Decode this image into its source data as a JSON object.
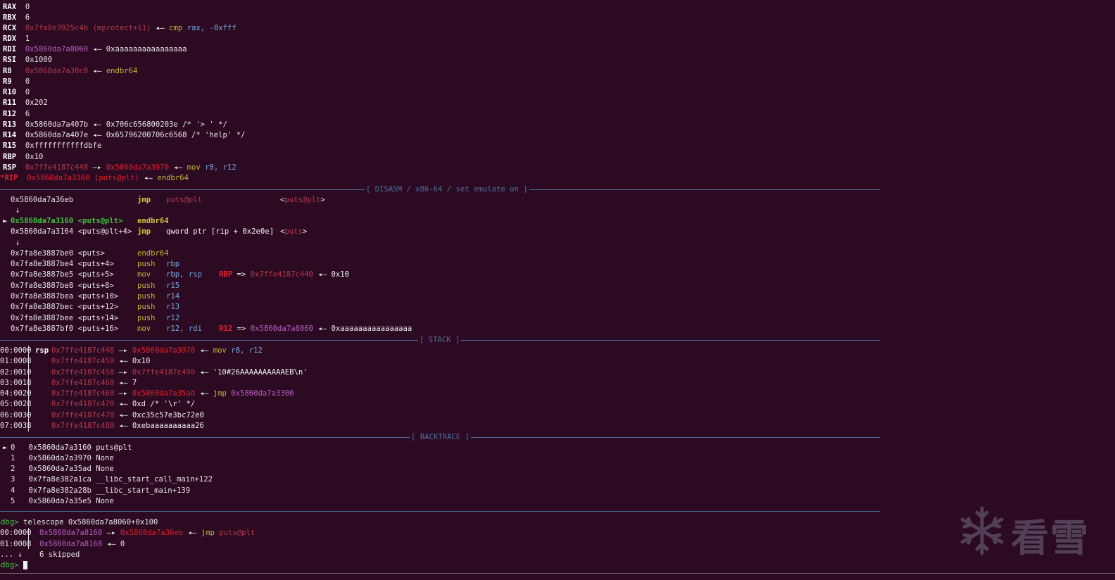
{
  "registers": [
    {
      "name": "RAX",
      "value": "0"
    },
    {
      "name": "RBX",
      "value": "6"
    },
    {
      "name": "RCX",
      "addr": "0x7fa8e3925c4b",
      "sym": "(mprotect+11)",
      "arrow": "◂—",
      "insn": "cmp",
      "ops": "rax, -0xfff"
    },
    {
      "name": "RDX",
      "value": "1"
    },
    {
      "name": "RDI",
      "addr": "0x5860da7a8060",
      "arrow": "◂—",
      "target": "0xaaaaaaaaaaaaaaaa"
    },
    {
      "name": "RSI",
      "value": "0x1000"
    },
    {
      "name": "R8",
      "addr": "0x5860da7a38c0",
      "arrow": "◂—",
      "insn": "endbr64"
    },
    {
      "name": "R9",
      "value": "0"
    },
    {
      "name": "R10",
      "value": "0"
    },
    {
      "name": "R11",
      "value": "0x202"
    },
    {
      "name": "R12",
      "value": "6"
    },
    {
      "name": "R13",
      "value": "0x5860da7a407b ◂— 0x706c656800203e /* '> ' */"
    },
    {
      "name": "R14",
      "value": "0x5860da7a407e ◂— 0x65796200706c6568 /* 'help' */"
    },
    {
      "name": "R15",
      "value": "0xfffffffffffdbfe"
    },
    {
      "name": "RBP",
      "value": "0x10"
    },
    {
      "name": "RSP",
      "addr": "0x7ffe4187c448",
      "arrow": "—▸",
      "addr2": "0x5860da7a3970",
      "arrow2": "◂—",
      "insn": "mov",
      "ops": "r8, r12"
    },
    {
      "name": "*RIP",
      "addr": "0x5860da7a3160",
      "sym": "(puts@plt)",
      "arrow": "◂—",
      "insn": "endbr64"
    }
  ],
  "headers": {
    "disasm": "[ DISASM / x86-64 / set emulate on ]",
    "stack": "[ STACK ]",
    "backtrace": "[ BACKTRACE ]"
  },
  "disasm": [
    {
      "addr": "0x5860da7a36eb",
      "label": "",
      "mn": "jmp",
      "op": "puts@plt",
      "cmt": "<puts@plt>"
    },
    {
      "down": "↓"
    },
    {
      "addr": "0x5860da7a3160",
      "label": "<puts@plt>",
      "mn": "endbr64",
      "current": true,
      "marker": "►"
    },
    {
      "addr": "0x5860da7a3164",
      "label": "<puts@plt+4>",
      "mn": "jmp",
      "op": "qword ptr [rip + 0x2e0e]",
      "cmt": "<puts>"
    },
    {
      "down": "↓"
    },
    {
      "addr": "0x7fa8e3887be0",
      "label": "<puts>",
      "mn": "endbr64"
    },
    {
      "addr": "0x7fa8e3887be4",
      "label": "<puts+4>",
      "mn": "push",
      "op": "rbp"
    },
    {
      "addr": "0x7fa8e3887be5",
      "label": "<puts+5>",
      "mn": "mov",
      "op": "rbp, rsp",
      "cmt": "RBP => 0x7ffe4187c440 ◂— 0x10"
    },
    {
      "addr": "0x7fa8e3887be8",
      "label": "<puts+8>",
      "mn": "push",
      "op": "r15"
    },
    {
      "addr": "0x7fa8e3887bea",
      "label": "<puts+10>",
      "mn": "push",
      "op": "r14"
    },
    {
      "addr": "0x7fa8e3887bec",
      "label": "<puts+12>",
      "mn": "push",
      "op": "r13"
    },
    {
      "addr": "0x7fa8e3887bee",
      "label": "<puts+14>",
      "mn": "push",
      "op": "r12"
    },
    {
      "addr": "0x7fa8e3887bf0",
      "label": "<puts+16>",
      "mn": "mov",
      "op": "r12, rdi",
      "cmt": "R12 => 0x5860da7a8060 ◂— 0xaaaaaaaaaaaaaaaa"
    }
  ],
  "stack": [
    {
      "off": "00:0000",
      "tag": "rsp",
      "addr": "0x7ffe4187c448",
      "rest": "—▸ 0x5860da7a3970 ◂— mov r8, r12"
    },
    {
      "off": "01:0008",
      "tag": "",
      "addr": "0x7ffe4187c450",
      "rest": "◂— 0x10"
    },
    {
      "off": "02:0010",
      "tag": "",
      "addr": "0x7ffe4187c458",
      "rest": "—▸ 0x7ffe4187c490 ◂— '10#26AAAAAAAAAAEB\\n'"
    },
    {
      "off": "03:0018",
      "tag": "",
      "addr": "0x7ffe4187c460",
      "rest": "◂— 7"
    },
    {
      "off": "04:0020",
      "tag": "",
      "addr": "0x7ffe4187c468",
      "rest": "—▸ 0x5860da7a35ad ◂— jmp 0x5860da7a3300"
    },
    {
      "off": "05:0028",
      "tag": "",
      "addr": "0x7ffe4187c470",
      "rest": "◂— 0xd /* '\\r' */"
    },
    {
      "off": "06:0030",
      "tag": "",
      "addr": "0x7ffe4187c478",
      "rest": "◂— 0xc35c57e3bc72e0"
    },
    {
      "off": "07:0038",
      "tag": "",
      "addr": "0x7ffe4187c480",
      "rest": "◂— 0xebaaaaaaaaaa26"
    }
  ],
  "backtrace": [
    {
      "marker": "►",
      "idx": "0",
      "addr": "0x5860da7a3160",
      "sym": "puts@plt"
    },
    {
      "marker": "",
      "idx": "1",
      "addr": "0x5860da7a3970",
      "sym": "None"
    },
    {
      "marker": "",
      "idx": "2",
      "addr": "0x5860da7a35ad",
      "sym": "None"
    },
    {
      "marker": "",
      "idx": "3",
      "addr": "0x7fa8e382a1ca",
      "sym": "__libc_start_call_main+122"
    },
    {
      "marker": "",
      "idx": "4",
      "addr": "0x7fa8e382a28b",
      "sym": "__libc_start_main+139"
    },
    {
      "marker": "",
      "idx": "5",
      "addr": "0x5860da7a35e5",
      "sym": "None"
    }
  ],
  "telescope": {
    "prompt": "pwndbg>",
    "command": "telescope 0x5860da7a8060+0x100",
    "rows": [
      {
        "off": "00:0000",
        "addr": "0x5860da7a8160",
        "rest_addr": "0x5860da7a36eb",
        "insn": "jmp",
        "op": "puts@plt"
      },
      {
        "off": "01:0008",
        "addr": "0x5860da7a8168",
        "value": "0"
      }
    ],
    "skip_prefix": "... ↓",
    "skip_text": "6 skipped",
    "final_prompt": "pwndbg>"
  },
  "watermark": {
    "text": "看雪",
    "icon": "snowflake-icon"
  }
}
